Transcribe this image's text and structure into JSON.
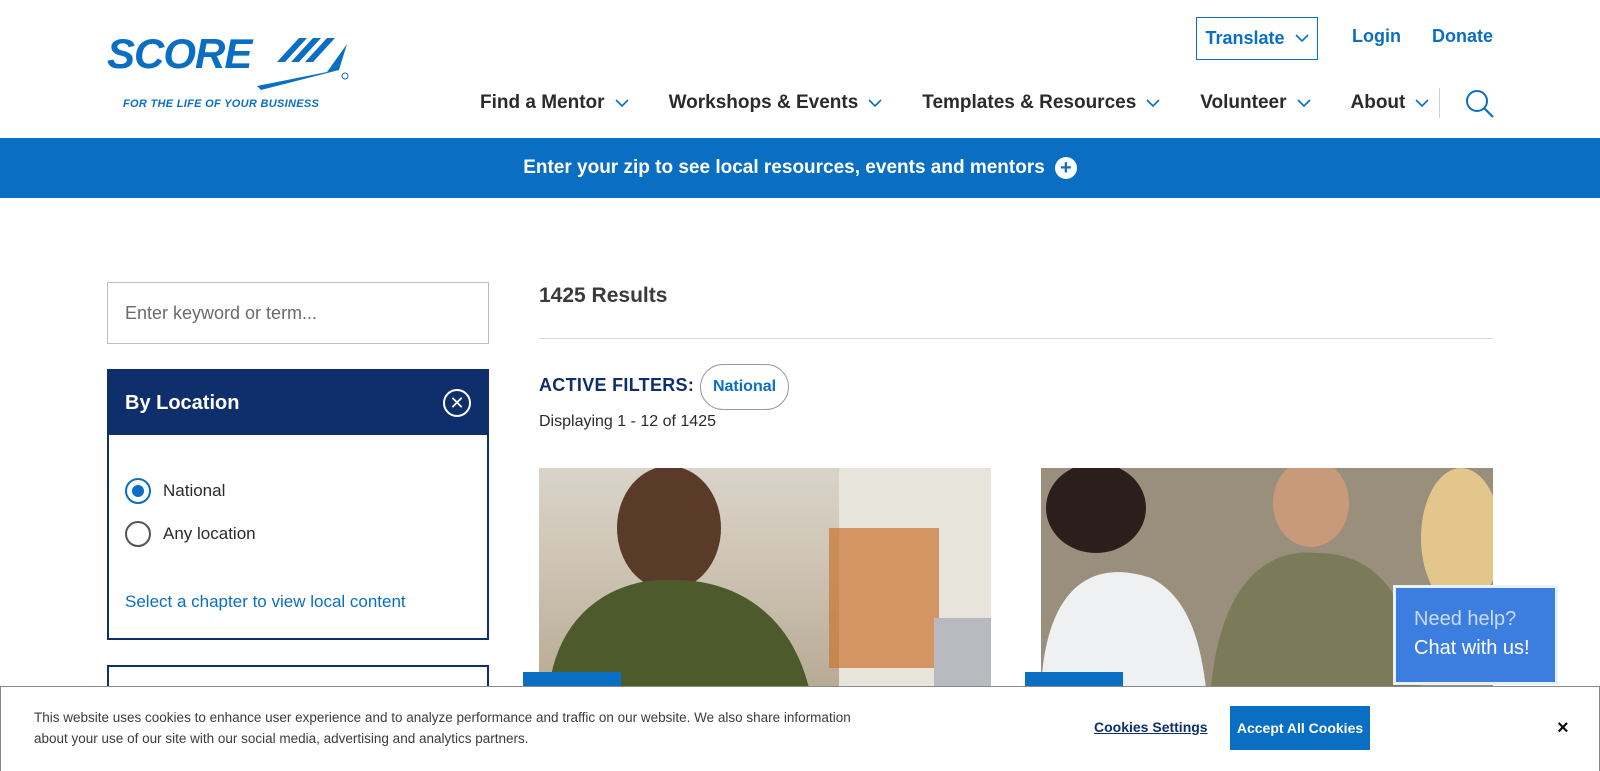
{
  "header": {
    "logo": {
      "wordmark": "SCORE",
      "tagline": "FOR THE LIFE OF YOUR BUSINESS"
    },
    "translate_label": "Translate",
    "login_label": "Login",
    "donate_label": "Donate",
    "nav": [
      {
        "label": "Find a Mentor"
      },
      {
        "label": "Workshops & Events"
      },
      {
        "label": "Templates & Resources"
      },
      {
        "label": "Volunteer"
      },
      {
        "label": "About"
      }
    ]
  },
  "zip_banner": {
    "text": "Enter your zip to see local resources, events and mentors"
  },
  "sidebar": {
    "search": {
      "placeholder": "Enter keyword or term...",
      "value": ""
    },
    "location_panel": {
      "title": "By Location",
      "options": [
        {
          "label": "National",
          "checked": true
        },
        {
          "label": "Any location",
          "checked": false
        }
      ],
      "chapter_link": "Select a chapter to view local content"
    }
  },
  "results": {
    "count_text": "1425 Results",
    "active_filters_label": "ACTIVE FILTERS:",
    "filters": [
      "National"
    ],
    "displaying_text": "Displaying 1 - 12 of 1425"
  },
  "chat": {
    "line1": "Need help?",
    "line2": "Chat with us!"
  },
  "cookie": {
    "text": "This website uses cookies to enhance user experience and to analyze performance and traffic on our website. We also share information about your use of our site with our social media, advertising and analytics partners.",
    "settings_label": "Cookies Settings",
    "accept_label": "Accept All Cookies",
    "close_glyph": "×"
  },
  "colors": {
    "brand_blue": "#0a6fc2",
    "navy": "#0e2f6b"
  }
}
